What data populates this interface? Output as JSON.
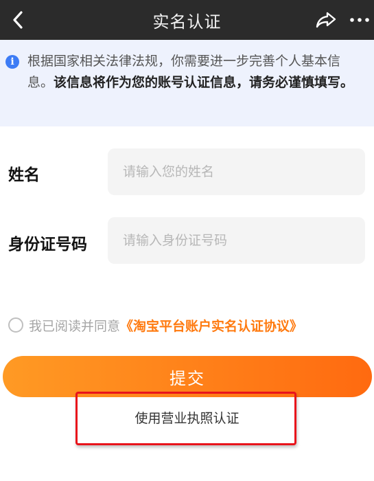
{
  "navbar": {
    "title": "实名认证",
    "back_icon": "chevron-left-icon",
    "share_icon": "share-icon",
    "more_icon": "more-dots-icon"
  },
  "notice": {
    "icon": "info-icon",
    "icon_glyph": "i",
    "text_normal": "根据国家相关法律法规，你需要进一步完善个人基本信息。",
    "text_bold": "该信息将作为您的账号认证信息，请务必谨慎填写。"
  },
  "form": {
    "name_label": "姓名",
    "name_placeholder": "请输入您的姓名",
    "id_label": "身份证号码",
    "id_placeholder": "请输入身份证号码"
  },
  "agreement": {
    "prefix": "我已阅读并同意",
    "link": "《淘宝平台账户实名认证协议》"
  },
  "submit_label": "提交",
  "license_link": "使用营业执照认证",
  "colors": {
    "navbar_bg": "#2b2b2b",
    "notice_bg": "#eef2fd",
    "info_icon": "#3d7cf5",
    "accent_orange": "#ff7a0f",
    "highlight_red": "#e8131b"
  }
}
